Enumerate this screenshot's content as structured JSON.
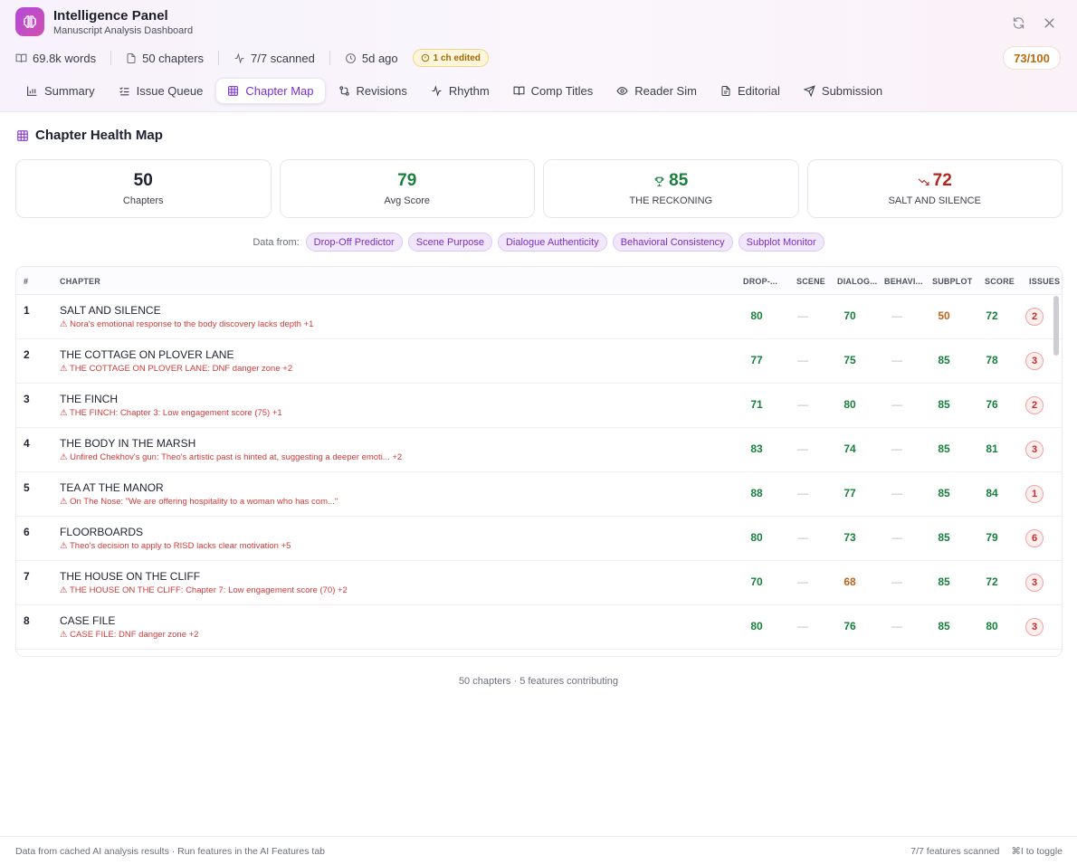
{
  "app": {
    "title": "Intelligence Panel",
    "subtitle": "Manuscript Analysis Dashboard",
    "icon": "brain-icon"
  },
  "stats": {
    "words": "69.8k words",
    "chapters": "50 chapters",
    "scanned": "7/7 scanned",
    "updated": "5d ago",
    "edited_badge": "1 ch edited",
    "overall_score": "73/100"
  },
  "tabs": [
    {
      "label": "Summary",
      "icon": "bar-chart-icon"
    },
    {
      "label": "Issue Queue",
      "icon": "list-check-icon"
    },
    {
      "label": "Chapter Map",
      "icon": "grid-icon",
      "active": true
    },
    {
      "label": "Revisions",
      "icon": "git-compare-icon"
    },
    {
      "label": "Rhythm",
      "icon": "pulse-icon"
    },
    {
      "label": "Comp Titles",
      "icon": "book-open-icon"
    },
    {
      "label": "Reader Sim",
      "icon": "eye-icon"
    },
    {
      "label": "Editorial",
      "icon": "file-text-icon"
    },
    {
      "label": "Submission",
      "icon": "send-icon"
    }
  ],
  "section": {
    "title": "Chapter Health Map"
  },
  "cards": [
    {
      "value": "50",
      "label": "Chapters",
      "color": "#1d2030"
    },
    {
      "value": "79",
      "label": "Avg Score",
      "color": "#17803d"
    },
    {
      "value": "85",
      "label": "THE RECKONING",
      "color": "#17803d",
      "icon": "trophy-icon"
    },
    {
      "value": "72",
      "label": "SALT AND SILENCE",
      "color": "#b3261e",
      "icon": "trending-down-icon"
    }
  ],
  "data_from": {
    "label": "Data from:",
    "chips": [
      "Drop-Off Predictor",
      "Scene Purpose",
      "Dialogue Authenticity",
      "Behavioral Consistency",
      "Subplot Monitor"
    ]
  },
  "table": {
    "headers": {
      "num": "#",
      "chapter": "CHAPTER",
      "dropoff": "DROP-...",
      "scene": "SCENE",
      "dialogue": "DIALOG...",
      "behavior": "BEHAVI...",
      "subplot": "SUBPLOT",
      "score": "SCORE",
      "issues": "ISSUES"
    },
    "rows": [
      {
        "num": "1",
        "name": "SALT AND SILENCE",
        "issue": "⚠ Nora's emotional response to the body discovery lacks depth +1",
        "dropoff": "80",
        "scene": "—",
        "dialogue": "70",
        "behavior": "—",
        "subplot": "50",
        "score": "72",
        "issues": "2"
      },
      {
        "num": "2",
        "name": "THE COTTAGE ON PLOVER LANE",
        "issue": "⚠ THE COTTAGE ON PLOVER LANE: DNF danger zone +2",
        "dropoff": "77",
        "scene": "—",
        "dialogue": "75",
        "behavior": "—",
        "subplot": "85",
        "score": "78",
        "issues": "3"
      },
      {
        "num": "3",
        "name": "THE FINCH",
        "issue": "⚠ THE FINCH: Chapter 3: Low engagement score (75) +1",
        "dropoff": "71",
        "scene": "—",
        "dialogue": "80",
        "behavior": "—",
        "subplot": "85",
        "score": "76",
        "issues": "2"
      },
      {
        "num": "4",
        "name": "THE BODY IN THE MARSH",
        "issue": "⚠ Unfired Chekhov's gun: Theo's artistic past is hinted at, suggesting a deeper emoti... +2",
        "dropoff": "83",
        "scene": "—",
        "dialogue": "74",
        "behavior": "—",
        "subplot": "85",
        "score": "81",
        "issues": "3"
      },
      {
        "num": "5",
        "name": "TEA AT THE MANOR",
        "issue": "⚠ On The Nose: \"We are offering hospitality to a woman who has com...\"",
        "dropoff": "88",
        "scene": "—",
        "dialogue": "77",
        "behavior": "—",
        "subplot": "85",
        "score": "84",
        "issues": "1"
      },
      {
        "num": "6",
        "name": "FLOORBOARDS",
        "issue": "⚠ Theo's decision to apply to RISD lacks clear motivation +5",
        "dropoff": "80",
        "scene": "—",
        "dialogue": "73",
        "behavior": "—",
        "subplot": "85",
        "score": "79",
        "issues": "6"
      },
      {
        "num": "7",
        "name": "THE HOUSE ON THE CLIFF",
        "issue": "⚠ THE HOUSE ON THE CLIFF: Chapter 7: Low engagement score (70) +2",
        "dropoff": "70",
        "scene": "—",
        "dialogue": "68",
        "behavior": "—",
        "subplot": "85",
        "score": "72",
        "issues": "3"
      },
      {
        "num": "8",
        "name": "CASE FILE",
        "issue": "⚠ CASE FILE: DNF danger zone +2",
        "dropoff": "80",
        "scene": "—",
        "dialogue": "76",
        "behavior": "—",
        "subplot": "85",
        "score": "80",
        "issues": "3"
      }
    ],
    "footer": "50 chapters · 5 features contributing"
  },
  "bottom_bar": {
    "left": "Data from cached AI analysis results · Run features in the AI Features tab",
    "scanned": "7/7 features scanned",
    "shortcut": "⌘I to toggle"
  },
  "colors": {
    "accent": "#7a2fc9",
    "good": "#17803d",
    "warn": "#c2611a",
    "bad": "#b3261e"
  }
}
